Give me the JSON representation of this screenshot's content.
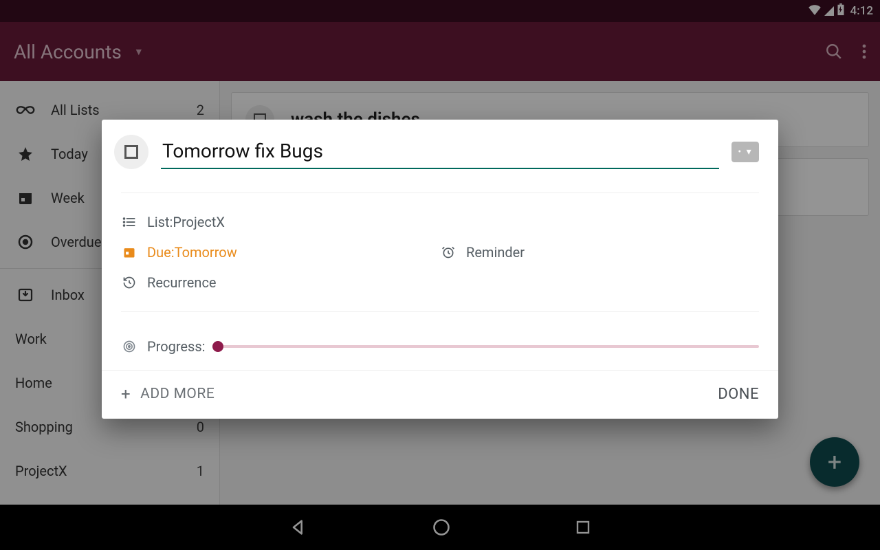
{
  "status": {
    "time": "4:12"
  },
  "appbar": {
    "title": "All Accounts"
  },
  "sidebar": {
    "nav": [
      {
        "label": "All Lists",
        "count": "2",
        "icon": "infinity"
      },
      {
        "label": "Today",
        "count": "",
        "icon": "star"
      },
      {
        "label": "Week",
        "count": "",
        "icon": "calendar"
      },
      {
        "label": "Overdue",
        "count": "",
        "icon": "target"
      }
    ],
    "inbox": {
      "label": "Inbox"
    },
    "lists": [
      {
        "label": "Work",
        "count": ""
      },
      {
        "label": "Home",
        "count": ""
      },
      {
        "label": "Shopping",
        "count": "0"
      },
      {
        "label": "ProjectX",
        "count": "1"
      }
    ]
  },
  "main": {
    "tasks": [
      {
        "title": "wash the dishes"
      }
    ]
  },
  "dialog": {
    "title_value": "Tomorrow fix Bugs",
    "list_prefix": "List: ",
    "list_value": "ProjectX",
    "due_prefix": "Due: ",
    "due_value": "Tomorrow",
    "reminder_label": "Reminder",
    "recurrence_label": "Recurrence",
    "progress_label": "Progress:",
    "progress_value": 0,
    "add_more_label": "ADD MORE",
    "done_label": "DONE",
    "priority_indicator": "• ▾"
  },
  "colors": {
    "accent": "#8e1b4b",
    "teal": "#00695c",
    "orange": "#e98b1b"
  }
}
